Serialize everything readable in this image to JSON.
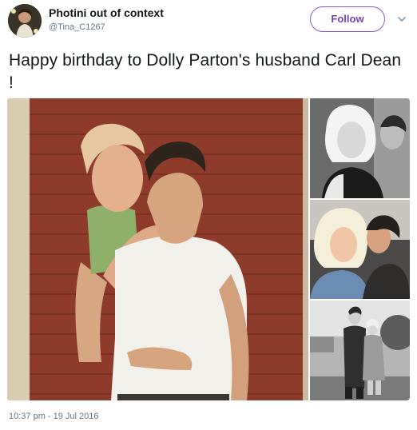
{
  "tweet": {
    "author_name": "Photini out of context",
    "author_handle": "@Tina_C1267",
    "follow_label": "Follow",
    "text": "Happy birthday to Dolly Parton's husband Carl Dean !",
    "timestamp": "10:37 pm - 19 Jul 2016"
  },
  "icons": {
    "menu": "chevron-down-icon",
    "avatar": "avatar"
  },
  "colors": {
    "follow_accent": "#6f42c1",
    "meta_text": "#657786",
    "body_text": "#14171a"
  }
}
